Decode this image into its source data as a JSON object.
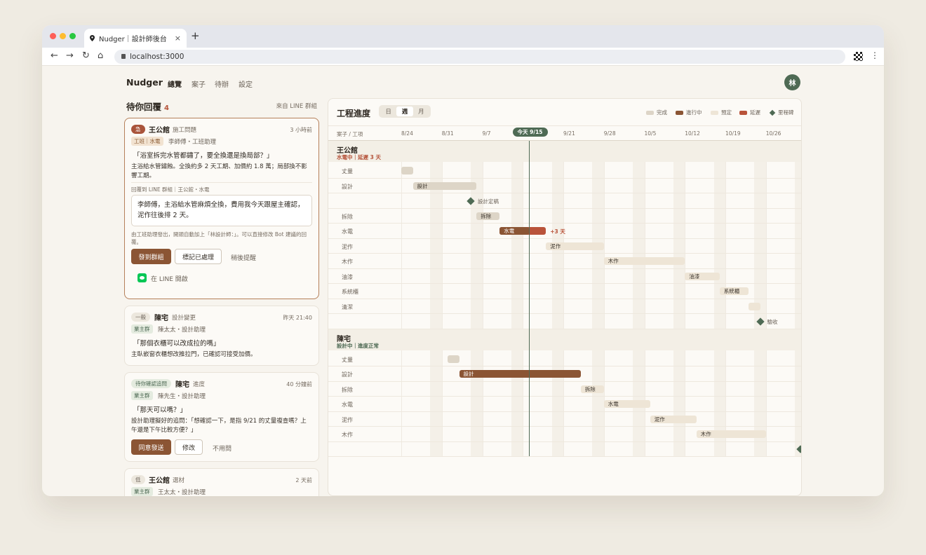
{
  "browser": {
    "tab_title": "Nudger｜設計師後台",
    "url": "localhost:3000",
    "new_tab": "+",
    "close": "×"
  },
  "nav": {
    "logo": "Nudger",
    "links": [
      "總覽",
      "案子",
      "待辦",
      "設定"
    ],
    "active": "總覽",
    "avatar": "林"
  },
  "inbox": {
    "title": "待你回覆",
    "count": "4",
    "source": "來自 LINE 群組",
    "cards": [
      {
        "priority": "急",
        "project": "王公館",
        "type": "施工問題",
        "time": "3 小時前",
        "role": "工班｜水電",
        "who": "李師傅・工班助理",
        "quote": "「浴室拆完水管都鏽了，要全換還是換局部？」",
        "summary": "主浴給水管鏽蝕。全換約多 2 天工期、加價約 1.8 萬；局部換不影響工期。",
        "reply_to": "回覆到 LINE 群組｜王公館・水電",
        "reply_text": "李師傅，主浴給水管麻煩全換，費用我今天跟屋主確認，泥作往後排 2 天。",
        "note": "由工班助理發出，開頭自動加上「林設計師：」。可以直接修改 Bot 建議的回覆。",
        "primary_btn": "發到群組",
        "secondary_btn": "標記已處理",
        "text_btn": "稍後提醒",
        "line_link": "在 LINE 開啟"
      },
      {
        "priority": "一般",
        "project": "陳宅",
        "type": "設計變更",
        "time": "昨天 21:40",
        "role": "業主群",
        "who": "陳太太・設計助理",
        "quote": "「那個衣櫃可以改成拉的嗎」",
        "summary": "主臥嵌窗衣櫃想改推拉門，已確認可接受加價。"
      },
      {
        "priority": "待你確認追問",
        "project": "陳宅",
        "type": "進度",
        "time": "40 分鐘前",
        "role": "業主群",
        "who": "陳先生・設計助理",
        "quote": "「那天可以嗎？」",
        "summary": "設計助理擬好的追問：「想確認一下，是指 9/21 的丈量複查嗎？上午還是下午比較方便？」",
        "primary_btn": "同意發送",
        "secondary_btn": "修改",
        "text_btn": "不用問"
      },
      {
        "priority": "低",
        "project": "王公館",
        "type": "選材",
        "time": "2 天前",
        "role": "業主群",
        "who": "王太太・設計助理"
      }
    ]
  },
  "gantt": {
    "title": "工程進度",
    "views": [
      "日",
      "週",
      "月"
    ],
    "active_view": "週",
    "legend": [
      {
        "label": "完成",
        "color": "#ddd5c7"
      },
      {
        "label": "進行中",
        "color": "#8b5534"
      },
      {
        "label": "預定",
        "color": "#eee5d6"
      },
      {
        "label": "延遲",
        "color": "#b9533a"
      },
      {
        "label": "里程碑",
        "color": "#4e6a54"
      }
    ],
    "axis_label": "案子 / 工項",
    "ticks": [
      "8/24",
      "8/31",
      "9/7",
      "9/14",
      "9/21",
      "9/28",
      "10/5",
      "10/12",
      "10/19",
      "10/26"
    ],
    "today_label": "今天 9/15",
    "today_day": 22,
    "projects": [
      {
        "name": "王公館",
        "status": "水電中｜延遲 3 天",
        "status_color": "#b5533a",
        "tasks": [
          {
            "label": "丈量",
            "start": 0,
            "end": 2,
            "state": "done",
            "bar_text": ""
          },
          {
            "label": "設計",
            "start": 2,
            "end": 13,
            "state": "done",
            "bar_text": "設計"
          },
          {
            "label": "",
            "milestone": 12,
            "ms_label": "設計定稿"
          },
          {
            "label": "拆除",
            "start": 13,
            "end": 17,
            "state": "done",
            "bar_text": "拆除"
          },
          {
            "label": "水電",
            "start": 17,
            "end": 22,
            "state": "active",
            "bar_text": "水電",
            "delay_end": 25,
            "delay_text": "+3 天"
          },
          {
            "label": "泥作",
            "start": 25,
            "end": 35,
            "state": "plan",
            "bar_text": "泥作"
          },
          {
            "label": "木作",
            "start": 35,
            "end": 49,
            "state": "plan",
            "bar_text": "木作"
          },
          {
            "label": "油漆",
            "start": 49,
            "end": 55,
            "state": "plan",
            "bar_text": "油漆"
          },
          {
            "label": "系統櫃",
            "start": 55,
            "end": 60,
            "state": "plan",
            "bar_text": "系統櫃"
          },
          {
            "label": "清潔",
            "start": 60,
            "end": 62,
            "state": "plan",
            "bar_text": ""
          },
          {
            "label": "",
            "milestone": 62,
            "ms_label": "驗收"
          }
        ]
      },
      {
        "name": "陳宅",
        "status": "設計中｜進度正常",
        "status_color": "#4e6a54",
        "tasks": [
          {
            "label": "丈量",
            "start": 8,
            "end": 10,
            "state": "done",
            "bar_text": ""
          },
          {
            "label": "設計",
            "start": 10,
            "end": 31,
            "state": "active",
            "bar_text": "設計"
          },
          {
            "label": "拆除",
            "start": 31,
            "end": 35,
            "state": "plan",
            "bar_text": "拆除"
          },
          {
            "label": "水電",
            "start": 35,
            "end": 43,
            "state": "plan",
            "bar_text": "水電"
          },
          {
            "label": "泥作",
            "start": 43,
            "end": 51,
            "state": "plan",
            "bar_text": "泥作"
          },
          {
            "label": "木作",
            "start": 51,
            "end": 63,
            "state": "plan",
            "bar_text": "木作"
          },
          {
            "label": "",
            "milestone": 69,
            "ms_label": ""
          }
        ]
      }
    ]
  }
}
